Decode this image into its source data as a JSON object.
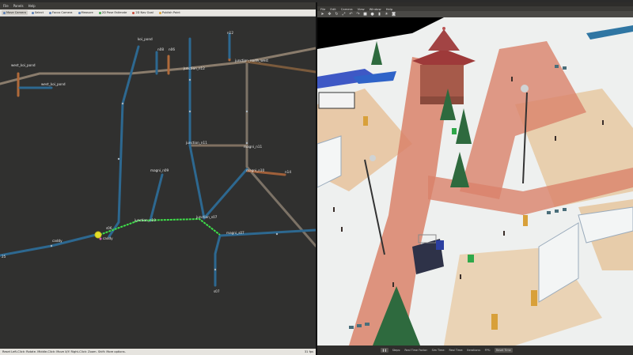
{
  "rviz": {
    "menu": [
      "File",
      "Panels",
      "Help"
    ],
    "tools": [
      {
        "label": "Move Camera",
        "icon": "move-camera-icon",
        "active": true
      },
      {
        "label": "Select",
        "icon": "select-icon",
        "active": false
      },
      {
        "label": "Focus Camera",
        "icon": "focus-camera-icon",
        "active": false
      },
      {
        "label": "Measure",
        "icon": "measure-icon",
        "active": false
      },
      {
        "label": "2D Pose Estimate",
        "icon": "pose-estimate-icon",
        "active": false
      },
      {
        "label": "2D Nav Goal",
        "icon": "nav-goal-icon",
        "active": false
      },
      {
        "label": "Publish Point",
        "icon": "publish-point-icon",
        "active": false
      }
    ],
    "status": {
      "hint": "Reset Left-Click: Rotate. Middle-Click: Move X/Y. Right-Click: Zoom. Shift: More options.",
      "fps": "31 fps"
    },
    "labels": {
      "west_koi_pond": "west_koi_pond",
      "west_koi_pond2": "west_koi_pond",
      "koi_pond": "koi_pond",
      "n08": "n08",
      "n06": "n06",
      "n12": "n12",
      "junction_n12": "junction_n12",
      "junction_north_west": "junction_north_west",
      "junction_n11": "junction_n11",
      "magni_n11": "magni_n11",
      "magni_n09": "magni_n09",
      "magni_n10": "magni_n10",
      "n14": "n14",
      "s06": "s06",
      "junction_n10": "junction_n10",
      "junction_s07": "junction_s07",
      "caddy_left": "caddy",
      "caddy_robot": "caddy",
      "magni_s07": "magni_s07",
      "s07": "s07",
      "edge_25": "25"
    }
  },
  "gazebo": {
    "window_title": "Gazebo",
    "menu": [
      "File",
      "Edit",
      "Camera",
      "View",
      "Window",
      "Help"
    ],
    "status": {
      "steps": "Steps:",
      "real_time_factor": "Real Time Factor:",
      "sim_time": "Sim Time:",
      "real_time": "Real Time:",
      "iterations": "Iterations:",
      "fps": "FPS:",
      "reset": "Reset Time"
    }
  }
}
